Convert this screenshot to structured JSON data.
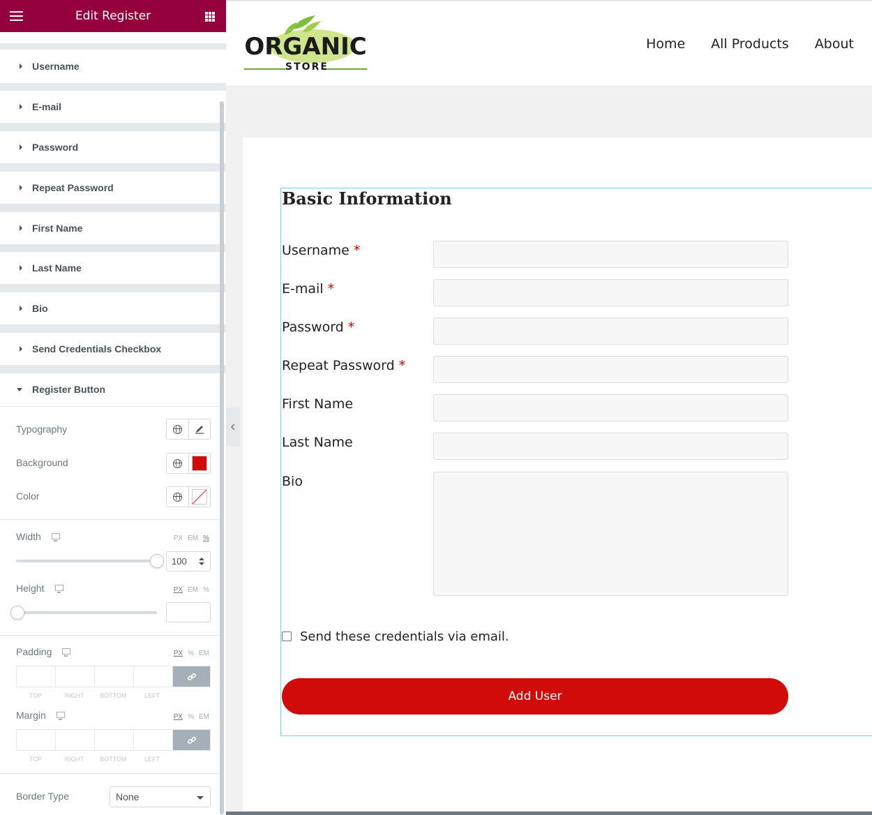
{
  "panel": {
    "title": "Edit Register",
    "sections": [
      "Username",
      "E-mail",
      "Password",
      "Repeat Password",
      "First Name",
      "Last Name",
      "Bio",
      "Send Credentials Checkbox",
      "Register Button"
    ],
    "controls": {
      "typography": "Typography",
      "background": "Background",
      "background_color": "#d10a0a",
      "color": "Color",
      "width": "Width",
      "width_value": "100",
      "width_percent": 1.0,
      "height": "Height",
      "height_percent": 0.0,
      "units_width": [
        "PX",
        "EM",
        "%"
      ],
      "units_height": [
        "PX",
        "EM",
        "%"
      ],
      "padding": "Padding",
      "margin": "Margin",
      "units_padding": [
        "PX",
        "%",
        "EM"
      ],
      "units_margin": [
        "PX",
        "%",
        "EM"
      ],
      "dim_labels": [
        "TOP",
        "RIGHT",
        "BOTTOM",
        "LEFT"
      ],
      "border_type": "Border Type",
      "border_type_value": "None"
    }
  },
  "site": {
    "logo_text_top": "ORGANIC",
    "logo_text_bottom": "STORE",
    "nav": [
      "Home",
      "All Products",
      "About"
    ]
  },
  "form": {
    "title": "Basic Information",
    "fields": [
      {
        "label": "Username",
        "required": true
      },
      {
        "label": "E-mail",
        "required": true
      },
      {
        "label": "Password",
        "required": true
      },
      {
        "label": "Repeat Password",
        "required": true
      },
      {
        "label": "First Name",
        "required": false
      },
      {
        "label": "Last Name",
        "required": false
      },
      {
        "label": "Bio",
        "required": false
      }
    ],
    "required_mark": "*",
    "checkbox_label": "Send these credentials via email.",
    "submit_label": "Add User",
    "submit_color": "#d10a0a"
  }
}
